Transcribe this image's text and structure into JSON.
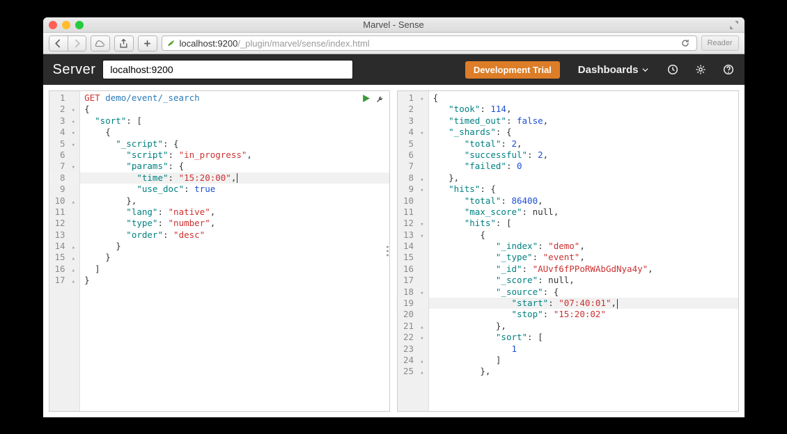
{
  "window": {
    "title": "Marvel - Sense",
    "reader_label": "Reader"
  },
  "url": {
    "host": "localhost:9200",
    "path": "/_plugin/marvel/sense/index.html"
  },
  "app": {
    "brand": "Server",
    "server_value": "localhost:9200",
    "trial_label": "Development Trial",
    "nav_dashboards": "Dashboards"
  },
  "request": {
    "method": "GET",
    "path": "demo/event/_search",
    "highlighted_line": 8,
    "lines": [
      {
        "n": "1",
        "fold": "",
        "tokens": [
          [
            "method",
            "GET"
          ],
          [
            "sp",
            " "
          ],
          [
            "url",
            "demo/event/_search"
          ]
        ]
      },
      {
        "n": "2",
        "fold": "▾",
        "tokens": [
          [
            "punc",
            "{"
          ]
        ]
      },
      {
        "n": "3",
        "fold": "▾",
        "tokens": [
          [
            "pad",
            "  "
          ],
          [
            "key",
            "\"sort\""
          ],
          [
            "colon",
            ": "
          ],
          [
            "punc",
            "["
          ]
        ]
      },
      {
        "n": "4",
        "fold": "▾",
        "tokens": [
          [
            "pad",
            "    "
          ],
          [
            "punc",
            "{"
          ]
        ]
      },
      {
        "n": "5",
        "fold": "▾",
        "tokens": [
          [
            "pad",
            "      "
          ],
          [
            "key",
            "\"_script\""
          ],
          [
            "colon",
            ": "
          ],
          [
            "punc",
            "{"
          ]
        ]
      },
      {
        "n": "6",
        "fold": "",
        "tokens": [
          [
            "pad",
            "        "
          ],
          [
            "key",
            "\"script\""
          ],
          [
            "colon",
            ": "
          ],
          [
            "str",
            "\"in_progress\""
          ],
          [
            "punc",
            ","
          ]
        ]
      },
      {
        "n": "7",
        "fold": "▾",
        "tokens": [
          [
            "pad",
            "        "
          ],
          [
            "key",
            "\"params\""
          ],
          [
            "colon",
            ": "
          ],
          [
            "punc",
            "{"
          ]
        ]
      },
      {
        "n": "8",
        "fold": "",
        "tokens": [
          [
            "pad",
            "          "
          ],
          [
            "key",
            "\"time\""
          ],
          [
            "colon",
            ": "
          ],
          [
            "str",
            "\"15:20:00\""
          ],
          [
            "punc",
            ","
          ],
          [
            "cursor",
            ""
          ]
        ]
      },
      {
        "n": "9",
        "fold": "",
        "tokens": [
          [
            "pad",
            "          "
          ],
          [
            "key",
            "\"use_doc\""
          ],
          [
            "colon",
            ": "
          ],
          [
            "bool",
            "true"
          ]
        ]
      },
      {
        "n": "10",
        "fold": "▴",
        "tokens": [
          [
            "pad",
            "        "
          ],
          [
            "punc",
            "},"
          ]
        ]
      },
      {
        "n": "11",
        "fold": "",
        "tokens": [
          [
            "pad",
            "        "
          ],
          [
            "key",
            "\"lang\""
          ],
          [
            "colon",
            ": "
          ],
          [
            "str",
            "\"native\""
          ],
          [
            "punc",
            ","
          ]
        ]
      },
      {
        "n": "12",
        "fold": "",
        "tokens": [
          [
            "pad",
            "        "
          ],
          [
            "key",
            "\"type\""
          ],
          [
            "colon",
            ": "
          ],
          [
            "str",
            "\"number\""
          ],
          [
            "punc",
            ","
          ]
        ]
      },
      {
        "n": "13",
        "fold": "",
        "tokens": [
          [
            "pad",
            "        "
          ],
          [
            "key",
            "\"order\""
          ],
          [
            "colon",
            ": "
          ],
          [
            "str",
            "\"desc\""
          ]
        ]
      },
      {
        "n": "14",
        "fold": "▴",
        "tokens": [
          [
            "pad",
            "      "
          ],
          [
            "punc",
            "}"
          ]
        ]
      },
      {
        "n": "15",
        "fold": "▴",
        "tokens": [
          [
            "pad",
            "    "
          ],
          [
            "punc",
            "}"
          ]
        ]
      },
      {
        "n": "16",
        "fold": "▴",
        "tokens": [
          [
            "pad",
            "  "
          ],
          [
            "punc",
            "]"
          ]
        ]
      },
      {
        "n": "17",
        "fold": "▴",
        "tokens": [
          [
            "punc",
            "}"
          ]
        ]
      }
    ]
  },
  "response": {
    "highlighted_line": 19,
    "lines": [
      {
        "n": "1",
        "fold": "▾",
        "tokens": [
          [
            "punc",
            "{"
          ]
        ]
      },
      {
        "n": "2",
        "fold": "",
        "tokens": [
          [
            "pad",
            "   "
          ],
          [
            "key",
            "\"took\""
          ],
          [
            "colon",
            ": "
          ],
          [
            "num",
            "114"
          ],
          [
            "punc",
            ","
          ]
        ]
      },
      {
        "n": "3",
        "fold": "",
        "tokens": [
          [
            "pad",
            "   "
          ],
          [
            "key",
            "\"timed_out\""
          ],
          [
            "colon",
            ": "
          ],
          [
            "bool",
            "false"
          ],
          [
            "punc",
            ","
          ]
        ]
      },
      {
        "n": "4",
        "fold": "▾",
        "tokens": [
          [
            "pad",
            "   "
          ],
          [
            "key",
            "\"_shards\""
          ],
          [
            "colon",
            ": "
          ],
          [
            "punc",
            "{"
          ]
        ]
      },
      {
        "n": "5",
        "fold": "",
        "tokens": [
          [
            "pad",
            "      "
          ],
          [
            "key",
            "\"total\""
          ],
          [
            "colon",
            ": "
          ],
          [
            "num",
            "2"
          ],
          [
            "punc",
            ","
          ]
        ]
      },
      {
        "n": "6",
        "fold": "",
        "tokens": [
          [
            "pad",
            "      "
          ],
          [
            "key",
            "\"successful\""
          ],
          [
            "colon",
            ": "
          ],
          [
            "num",
            "2"
          ],
          [
            "punc",
            ","
          ]
        ]
      },
      {
        "n": "7",
        "fold": "",
        "tokens": [
          [
            "pad",
            "      "
          ],
          [
            "key",
            "\"failed\""
          ],
          [
            "colon",
            ": "
          ],
          [
            "num",
            "0"
          ]
        ]
      },
      {
        "n": "8",
        "fold": "▴",
        "tokens": [
          [
            "pad",
            "   "
          ],
          [
            "punc",
            "},"
          ]
        ]
      },
      {
        "n": "9",
        "fold": "▾",
        "tokens": [
          [
            "pad",
            "   "
          ],
          [
            "key",
            "\"hits\""
          ],
          [
            "colon",
            ": "
          ],
          [
            "punc",
            "{"
          ]
        ]
      },
      {
        "n": "10",
        "fold": "",
        "tokens": [
          [
            "pad",
            "      "
          ],
          [
            "key",
            "\"total\""
          ],
          [
            "colon",
            ": "
          ],
          [
            "num",
            "86400"
          ],
          [
            "punc",
            ","
          ]
        ]
      },
      {
        "n": "11",
        "fold": "",
        "tokens": [
          [
            "pad",
            "      "
          ],
          [
            "key",
            "\"max_score\""
          ],
          [
            "colon",
            ": "
          ],
          [
            "null",
            "null"
          ],
          [
            "punc",
            ","
          ]
        ]
      },
      {
        "n": "12",
        "fold": "▾",
        "tokens": [
          [
            "pad",
            "      "
          ],
          [
            "key",
            "\"hits\""
          ],
          [
            "colon",
            ": "
          ],
          [
            "punc",
            "["
          ]
        ]
      },
      {
        "n": "13",
        "fold": "▾",
        "tokens": [
          [
            "pad",
            "         "
          ],
          [
            "punc",
            "{"
          ]
        ]
      },
      {
        "n": "14",
        "fold": "",
        "tokens": [
          [
            "pad",
            "            "
          ],
          [
            "key",
            "\"_index\""
          ],
          [
            "colon",
            ": "
          ],
          [
            "str",
            "\"demo\""
          ],
          [
            "punc",
            ","
          ]
        ]
      },
      {
        "n": "15",
        "fold": "",
        "tokens": [
          [
            "pad",
            "            "
          ],
          [
            "key",
            "\"_type\""
          ],
          [
            "colon",
            ": "
          ],
          [
            "str",
            "\"event\""
          ],
          [
            "punc",
            ","
          ]
        ]
      },
      {
        "n": "16",
        "fold": "",
        "tokens": [
          [
            "pad",
            "            "
          ],
          [
            "key",
            "\"_id\""
          ],
          [
            "colon",
            ": "
          ],
          [
            "str",
            "\"AUvf6fPPoRWAbGdNya4y\""
          ],
          [
            "punc",
            ","
          ]
        ]
      },
      {
        "n": "17",
        "fold": "",
        "tokens": [
          [
            "pad",
            "            "
          ],
          [
            "key",
            "\"_score\""
          ],
          [
            "colon",
            ": "
          ],
          [
            "null",
            "null"
          ],
          [
            "punc",
            ","
          ]
        ]
      },
      {
        "n": "18",
        "fold": "▾",
        "tokens": [
          [
            "pad",
            "            "
          ],
          [
            "key",
            "\"_source\""
          ],
          [
            "colon",
            ": "
          ],
          [
            "punc",
            "{"
          ]
        ]
      },
      {
        "n": "19",
        "fold": "",
        "tokens": [
          [
            "pad",
            "               "
          ],
          [
            "key",
            "\"start\""
          ],
          [
            "colon",
            ": "
          ],
          [
            "str",
            "\"07:40:01\""
          ],
          [
            "punc",
            ","
          ],
          [
            "cursor",
            ""
          ]
        ]
      },
      {
        "n": "20",
        "fold": "",
        "tokens": [
          [
            "pad",
            "               "
          ],
          [
            "key",
            "\"stop\""
          ],
          [
            "colon",
            ": "
          ],
          [
            "str",
            "\"15:20:02\""
          ]
        ]
      },
      {
        "n": "21",
        "fold": "▴",
        "tokens": [
          [
            "pad",
            "            "
          ],
          [
            "punc",
            "},"
          ]
        ]
      },
      {
        "n": "22",
        "fold": "▾",
        "tokens": [
          [
            "pad",
            "            "
          ],
          [
            "key",
            "\"sort\""
          ],
          [
            "colon",
            ": "
          ],
          [
            "punc",
            "["
          ]
        ]
      },
      {
        "n": "23",
        "fold": "",
        "tokens": [
          [
            "pad",
            "               "
          ],
          [
            "num",
            "1"
          ]
        ]
      },
      {
        "n": "24",
        "fold": "▴",
        "tokens": [
          [
            "pad",
            "            "
          ],
          [
            "punc",
            "]"
          ]
        ]
      },
      {
        "n": "25",
        "fold": "▴",
        "tokens": [
          [
            "pad",
            "         "
          ],
          [
            "punc",
            "},"
          ]
        ]
      }
    ]
  }
}
